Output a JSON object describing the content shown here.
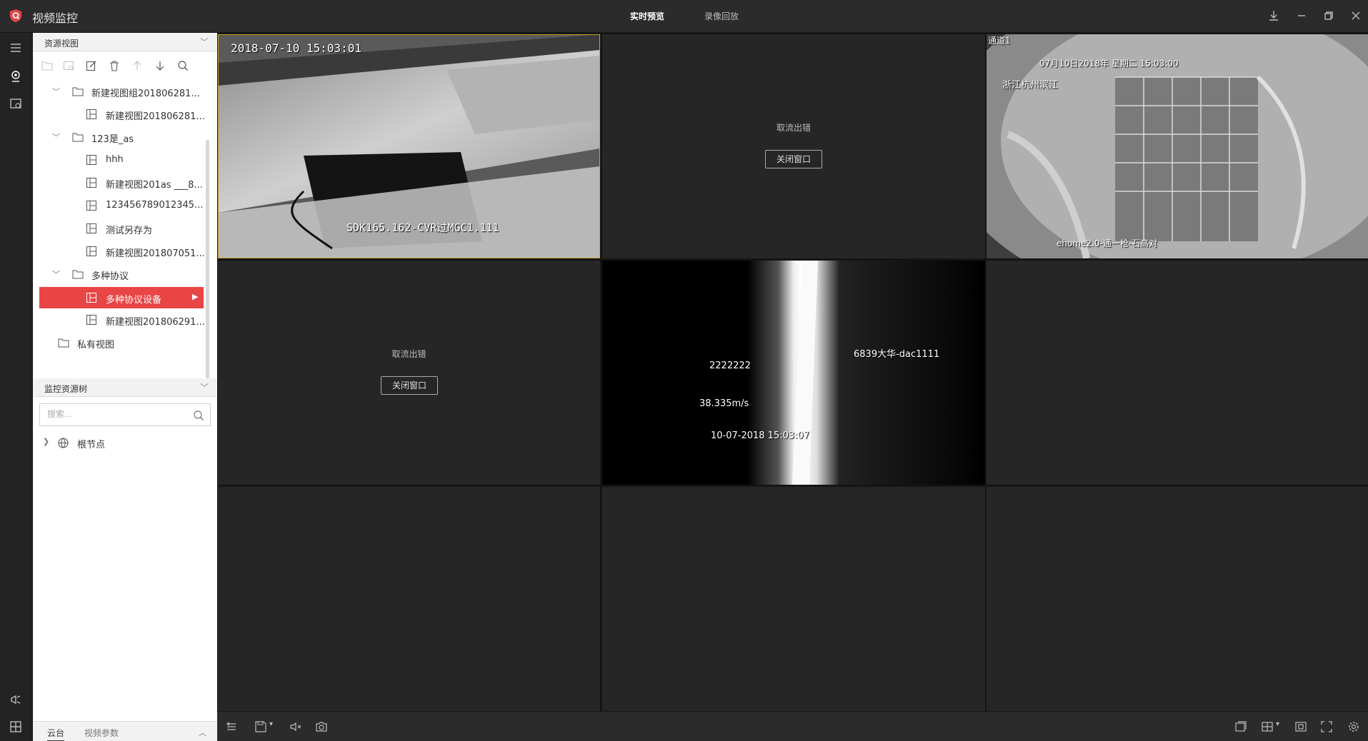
{
  "app": {
    "title": "视频监控",
    "brand_color": "#e94545"
  },
  "nav": {
    "tabs": [
      {
        "label": "实时预览",
        "active": true
      },
      {
        "label": "录像回放",
        "active": false
      }
    ]
  },
  "window_controls": [
    "download-icon",
    "minimize-icon",
    "restore-icon",
    "close-icon"
  ],
  "rail": {
    "icons": [
      "menu-icon",
      "live-view-icon",
      "playback-icon",
      "broadcast-icon",
      "grid-icon"
    ]
  },
  "resource_view": {
    "header": "资源视图",
    "toolbar": [
      "add-group-icon",
      "add-view-icon",
      "edit-icon",
      "delete-icon",
      "move-up-icon",
      "move-down-icon",
      "search-icon"
    ],
    "tree": [
      {
        "label": "新建视图组201806281...",
        "type": "folder",
        "level": 0,
        "expanded": true
      },
      {
        "label": "新建视图201806281...",
        "type": "view",
        "level": 1
      },
      {
        "label": "123是_as",
        "type": "folder",
        "level": 0,
        "expanded": true
      },
      {
        "label": "hhh",
        "type": "view",
        "level": 1
      },
      {
        "label": "新建视图201as ___8...",
        "type": "view",
        "level": 1
      },
      {
        "label": "123456789012345...",
        "type": "view",
        "level": 1
      },
      {
        "label": "测试另存为",
        "type": "view",
        "level": 1
      },
      {
        "label": "新建视图201807051...",
        "type": "view",
        "level": 1
      },
      {
        "label": "多种协议",
        "type": "folder",
        "level": 0,
        "expanded": true
      },
      {
        "label": "多种协议设备",
        "type": "view",
        "level": 1,
        "selected": true
      },
      {
        "label": "新建视图201806291...",
        "type": "view",
        "level": 1
      },
      {
        "label": "私有视图",
        "type": "folder",
        "level": -1
      }
    ]
  },
  "monitor_tree": {
    "header": "监控资源树",
    "search_placeholder": "搜索...",
    "root_label": "根节点"
  },
  "bottom_tabs": [
    {
      "label": "云台",
      "active": true
    },
    {
      "label": "视频参数",
      "active": false
    }
  ],
  "cells": [
    {
      "type": "video",
      "selected": true,
      "osd": [
        "2018-07-10 15:03:01",
        "SDK165.162-CVR过MGC1.111"
      ]
    },
    {
      "type": "error",
      "error_text": "取流出错",
      "button": "关闭窗口"
    },
    {
      "type": "video",
      "osd": [
        "通道1",
        "07月10日2018年 星期二 15:03:00",
        "浙江杭州滨江",
        "ehome2.0-通一枪-石高对"
      ]
    },
    {
      "type": "error",
      "error_text": "取流出错",
      "button": "关闭窗口"
    },
    {
      "type": "video",
      "osd": [
        "6839大华-dac1111",
        "2222222",
        "38.335m/s",
        "10-07-2018 15:03:07"
      ]
    },
    {
      "type": "empty"
    },
    {
      "type": "empty"
    },
    {
      "type": "empty"
    },
    {
      "type": "empty"
    }
  ],
  "bottom_toolbar": {
    "left": [
      "stop-all-icon",
      "save-icon",
      "mute-icon",
      "snapshot-icon"
    ],
    "right": [
      "window-mode-icon",
      "layout-icon",
      "fit-icon",
      "fullscreen-icon",
      "settings-icon"
    ]
  }
}
